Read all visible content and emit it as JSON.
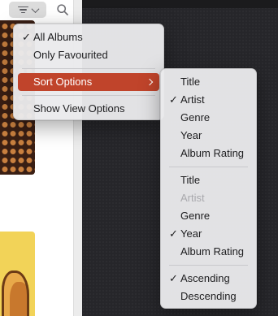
{
  "toolbar": {
    "view_button_icon": "view-options-icon",
    "search_icon": "search-icon"
  },
  "main_menu": {
    "items": [
      {
        "label": "All Albums",
        "checked": true
      },
      {
        "label": "Only Favourited",
        "checked": false
      },
      {
        "label": "Sort Options",
        "highlighted": true,
        "has_submenu": true
      },
      {
        "label": "Show View Options",
        "checked": false
      }
    ]
  },
  "sort_menu": {
    "group1": [
      {
        "label": "Title",
        "checked": false
      },
      {
        "label": "Artist",
        "checked": true
      },
      {
        "label": "Genre",
        "checked": false
      },
      {
        "label": "Year",
        "checked": false
      },
      {
        "label": "Album Rating",
        "checked": false
      }
    ],
    "group2": [
      {
        "label": "Title",
        "checked": false,
        "disabled": false
      },
      {
        "label": "Artist",
        "checked": false,
        "disabled": true
      },
      {
        "label": "Genre",
        "checked": false,
        "disabled": false
      },
      {
        "label": "Year",
        "checked": true,
        "disabled": false
      },
      {
        "label": "Album Rating",
        "checked": false,
        "disabled": false
      }
    ],
    "group3": [
      {
        "label": "Ascending",
        "checked": true
      },
      {
        "label": "Descending",
        "checked": false
      }
    ]
  },
  "check_glyph": "✓",
  "colors": {
    "highlight": "#c0442b",
    "menu_bg": "#eaeaec",
    "disabled_text": "#a9a9ad"
  }
}
